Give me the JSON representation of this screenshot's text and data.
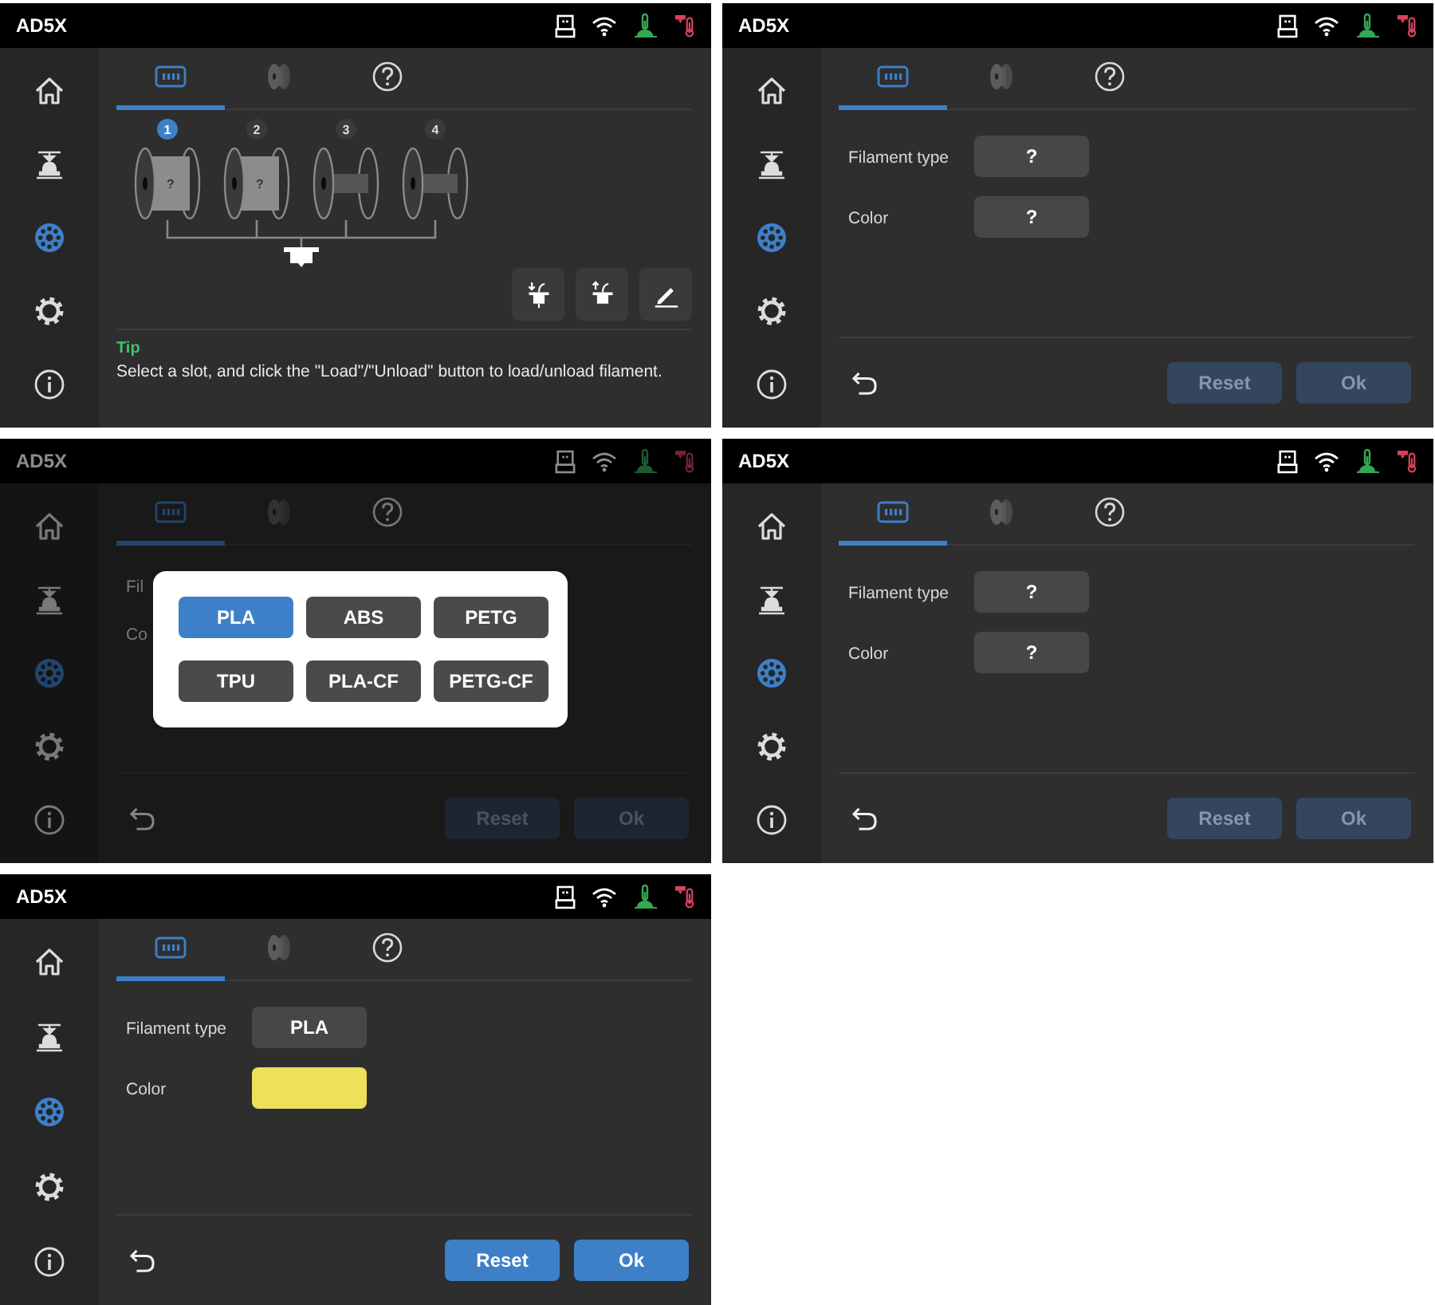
{
  "screens": [
    {
      "kind": "slots",
      "title": "AD5X",
      "sidebar": [
        {
          "selected": false
        },
        {
          "selected": false
        },
        {
          "selected": true
        },
        {
          "selected": false
        },
        {
          "selected": false
        }
      ],
      "tabs": [
        {
          "selected": true
        },
        {
          "selected": false
        },
        {
          "selected": false
        }
      ],
      "slots": [
        {
          "number": "1",
          "selected": true,
          "loaded": true,
          "label": "?"
        },
        {
          "number": "2",
          "selected": false,
          "loaded": true,
          "label": "?"
        },
        {
          "number": "3",
          "selected": false,
          "loaded": false
        },
        {
          "number": "4",
          "selected": false,
          "loaded": false
        }
      ],
      "tip": {
        "title": "Tip",
        "text": "Select a slot, and click the \"Load\"/\"Unload\" button to load/unload filament."
      }
    },
    {
      "kind": "edit",
      "title": "AD5X",
      "sidebar": [
        {
          "selected": false
        },
        {
          "selected": false
        },
        {
          "selected": true
        },
        {
          "selected": false
        },
        {
          "selected": false
        }
      ],
      "tabs": [
        {
          "selected": true
        },
        {
          "selected": false
        },
        {
          "selected": false
        }
      ],
      "fields": [
        {
          "label": "Filament type",
          "value": "?"
        },
        {
          "label": "Color",
          "value": "?"
        }
      ],
      "buttons": [
        {
          "label": "Reset",
          "disabled": true
        },
        {
          "label": "Ok",
          "disabled": true
        }
      ]
    },
    {
      "kind": "edit",
      "title": "AD5X",
      "sidebar": [
        {
          "selected": false
        },
        {
          "selected": false
        },
        {
          "selected": true
        },
        {
          "selected": false
        },
        {
          "selected": false
        }
      ],
      "tabs": [
        {
          "selected": true
        },
        {
          "selected": false
        },
        {
          "selected": false
        }
      ],
      "fields": [
        {
          "label": "Fil"
        },
        {
          "label": "Co"
        }
      ],
      "buttons": [
        {
          "label": "Reset",
          "disabled": true
        },
        {
          "label": "Ok",
          "disabled": true
        }
      ],
      "dialog": {
        "options": [
          {
            "label": "PLA",
            "selected": true
          },
          {
            "label": "ABS",
            "selected": false
          },
          {
            "label": "PETG",
            "selected": false
          },
          {
            "label": "TPU",
            "selected": false
          },
          {
            "label": "PLA-CF",
            "selected": false
          },
          {
            "label": "PETG-CF",
            "selected": false
          }
        ]
      }
    },
    {
      "kind": "edit",
      "title": "AD5X",
      "sidebar": [
        {
          "selected": false
        },
        {
          "selected": false
        },
        {
          "selected": true
        },
        {
          "selected": false
        },
        {
          "selected": false
        }
      ],
      "tabs": [
        {
          "selected": true
        },
        {
          "selected": false
        },
        {
          "selected": false
        }
      ],
      "fields": [
        {
          "label": "Filament type",
          "value": "?"
        },
        {
          "label": "Color",
          "value": "?"
        }
      ],
      "buttons": [
        {
          "label": "Reset",
          "disabled": true
        },
        {
          "label": "Ok",
          "disabled": true
        }
      ]
    },
    {
      "kind": "edit",
      "title": "AD5X",
      "sidebar": [
        {
          "selected": false
        },
        {
          "selected": false
        },
        {
          "selected": true
        },
        {
          "selected": false
        },
        {
          "selected": false
        }
      ],
      "tabs": [
        {
          "selected": true
        },
        {
          "selected": false
        },
        {
          "selected": false
        }
      ],
      "fields": [
        {
          "label": "Filament type",
          "value": "PLA"
        },
        {
          "label": "Color",
          "color": "#ede05a"
        }
      ],
      "buttons": [
        {
          "label": "Reset",
          "disabled": false
        },
        {
          "label": "Ok",
          "disabled": false
        }
      ]
    }
  ]
}
